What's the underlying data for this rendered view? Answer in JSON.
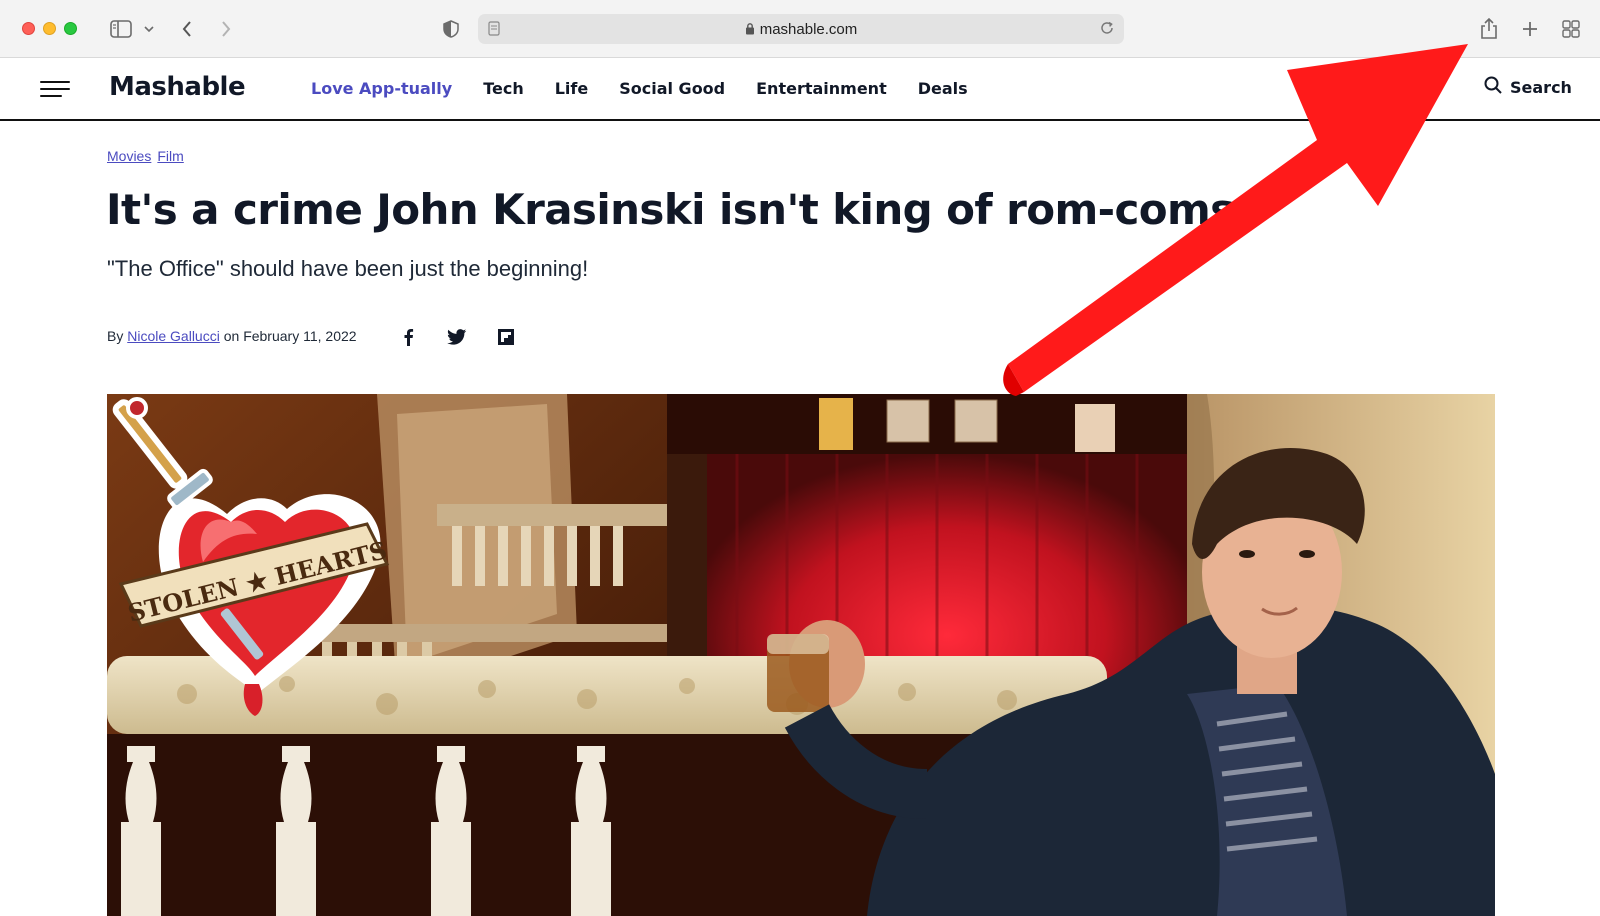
{
  "browser": {
    "url": "mashable.com"
  },
  "site": {
    "logo": "Mashable",
    "nav": [
      "Love App-tually",
      "Tech",
      "Life",
      "Social Good",
      "Entertainment",
      "Deals"
    ],
    "search_label": "Search",
    "accent_color": "#4b4bc0"
  },
  "article": {
    "breadcrumbs": [
      "Movies",
      "Film"
    ],
    "headline": "It's a crime John Krasinski isn't king of rom-coms",
    "dek": "\"The Office\" should have been just the beginning!",
    "byline_prefix": "By",
    "author": "Nicole Gallucci",
    "date_prefix": "on",
    "date": "February 11, 2022",
    "share_icons": [
      "facebook-icon",
      "twitter-icon",
      "flipboard-icon"
    ],
    "hero_sticker_text": "STOLEN ★ HEARTS"
  },
  "annotation": {
    "arrow_color": "#ff1a1a"
  }
}
